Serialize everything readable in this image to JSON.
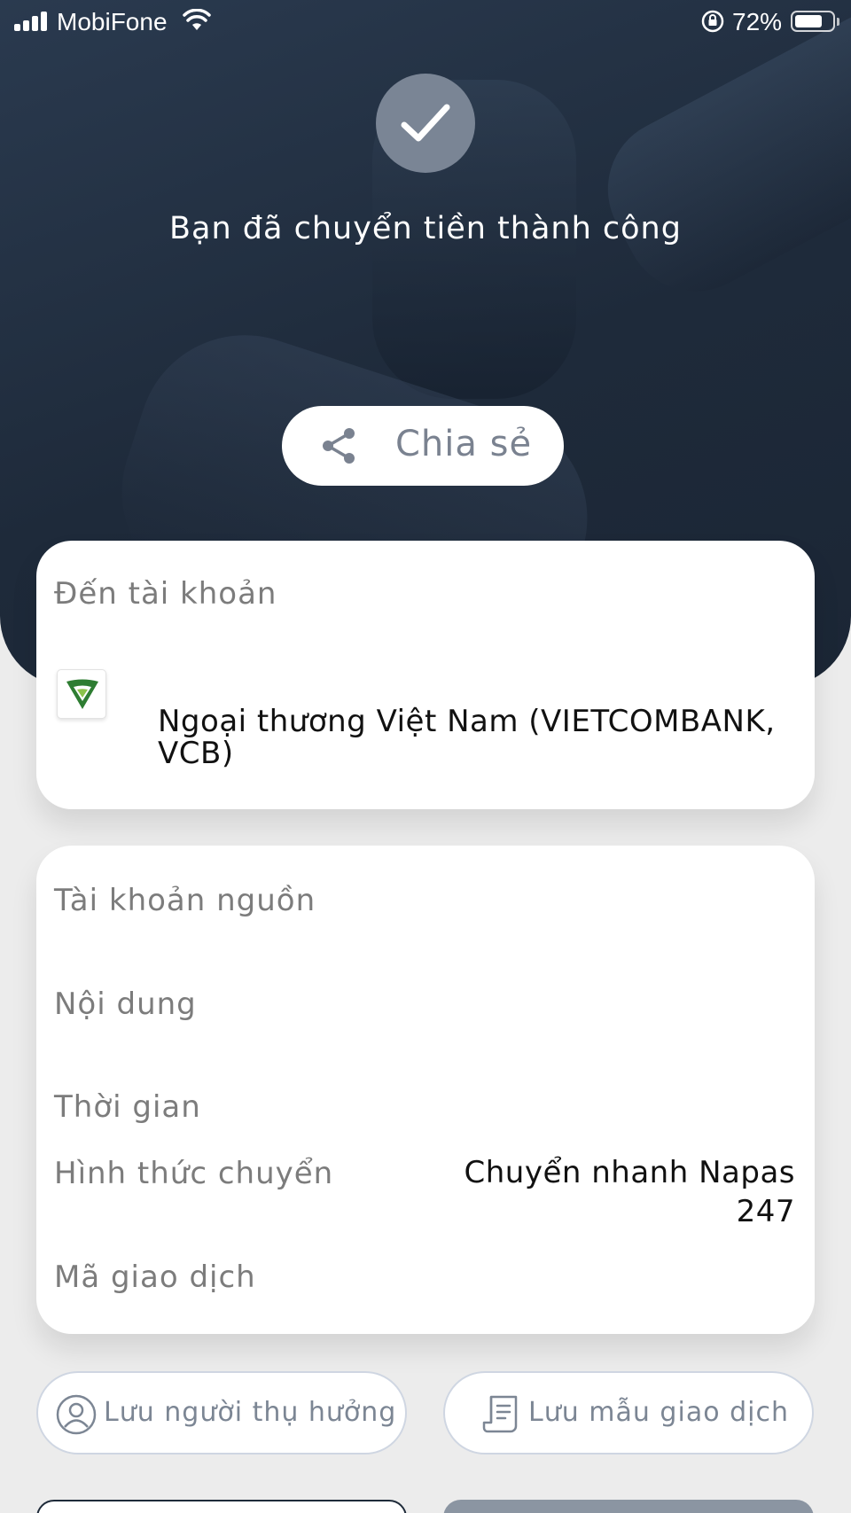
{
  "status_bar": {
    "carrier": "MobiFone",
    "battery": "72%"
  },
  "result": {
    "success_message": "Bạn đã chuyển tiền thành công",
    "share_label": "Chia sẻ"
  },
  "destination": {
    "label": "Đến tài khoản",
    "bank_name": "Ngoại thương Việt Nam (VIETCOMBANK, VCB)",
    "bank_logo_color": "#2e7d32"
  },
  "details": {
    "source_account_label": "Tài khoản nguồn",
    "content_label": "Nội dung",
    "time_label": "Thời gian",
    "method_label": "Hình thức chuyển",
    "method_value": "Chuyển nhanh Napas 247",
    "transaction_id_label": "Mã giao dịch"
  },
  "actions": {
    "save_payee": "Lưu người thụ hưởng",
    "save_template": "Lưu mẫu giao dịch"
  },
  "colors": {
    "header_bg": "#1e2a3a",
    "accent_gray": "#7a8595"
  }
}
